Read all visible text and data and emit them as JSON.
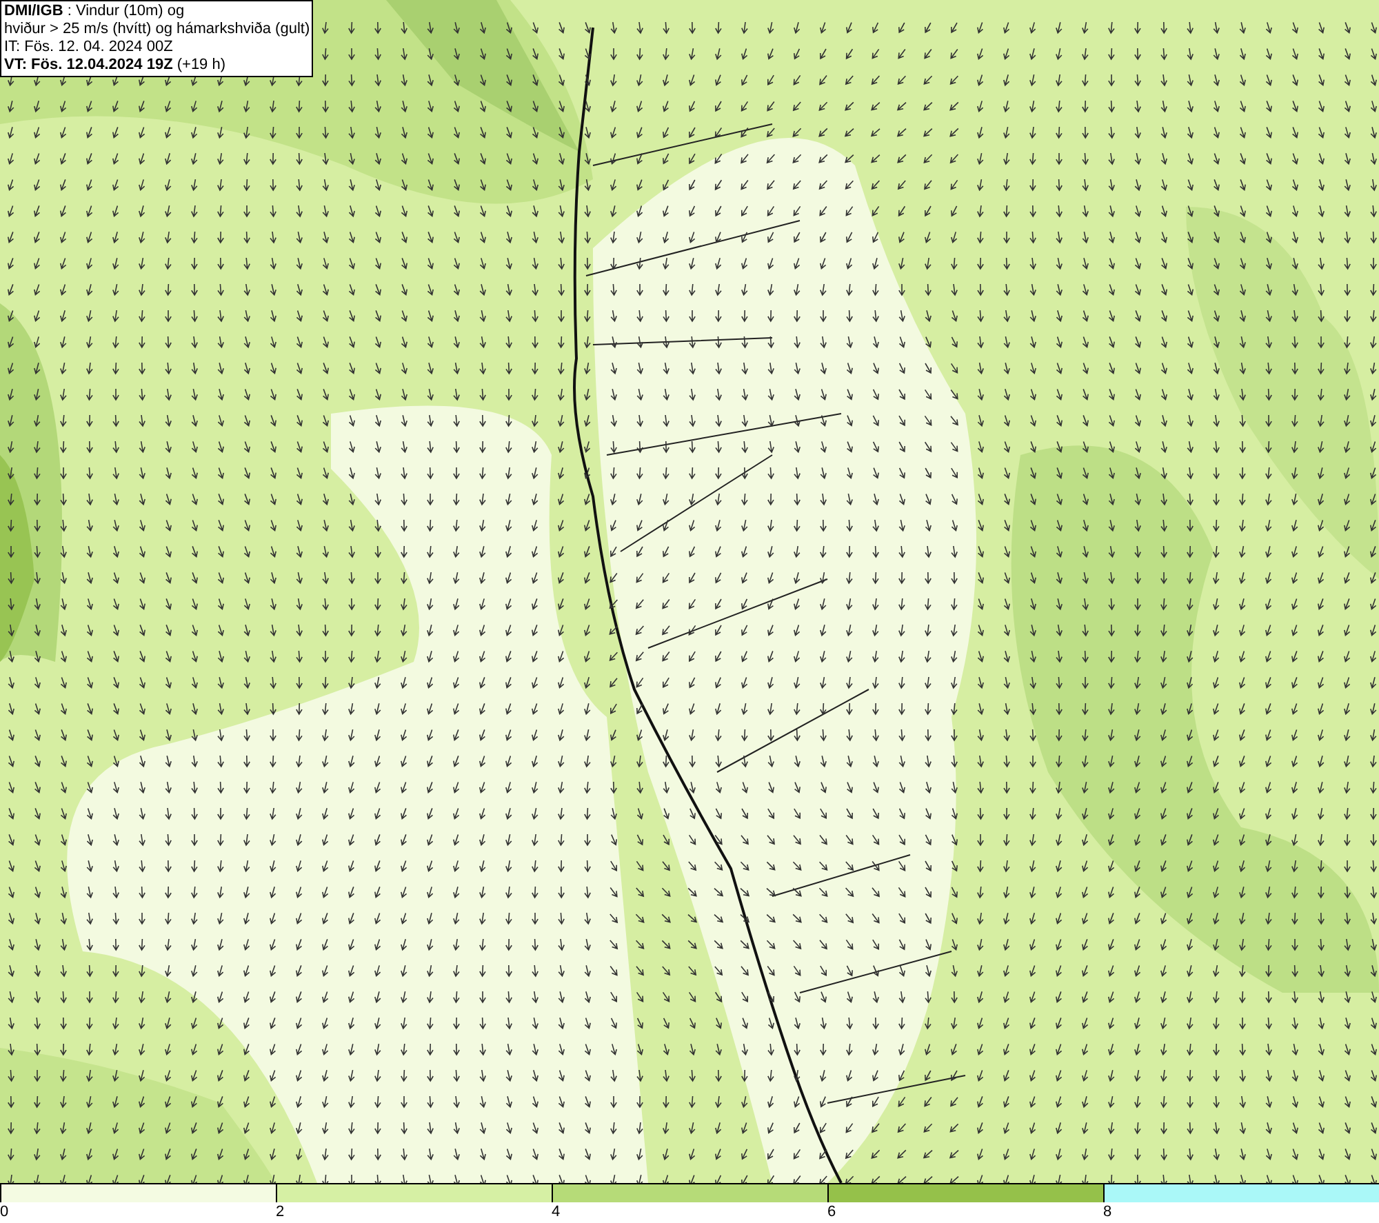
{
  "header": {
    "lines": [
      "**DMI/IGB** : Vindur (10m) og",
      "hviður > 25 m/s (hvítt) og hámarkshviða (gult)",
      "IT: Fös. 12. 04. 2024 00Z",
      "**VT: Fös. 12.04.2024 19Z** (+19 h)"
    ]
  },
  "legend": [
    {
      "label": "0",
      "color": "#f4fbe2"
    },
    {
      "label": "2",
      "color": "#d6f0a4"
    },
    {
      "label": "4",
      "color": "#b6db78"
    },
    {
      "label": "6",
      "color": "#95c14a"
    },
    {
      "label": "8",
      "color": "#aaf8f8"
    }
  ]
}
